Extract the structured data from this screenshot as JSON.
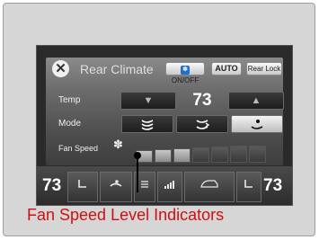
{
  "screen": {
    "title": "Rear Climate",
    "buttons": {
      "close_glyph": "✕",
      "onoff_icon": "fan-icon",
      "onoff_label": "ON/OFF",
      "auto_label": "AUTO",
      "rear_lock_label": "Rear Lock"
    },
    "rows": {
      "temp_label": "Temp",
      "mode_label": "Mode",
      "fan_label": "Fan Speed"
    },
    "temp": {
      "value": "73",
      "down_glyph": "▼",
      "up_glyph": "▲"
    },
    "modes": [
      {
        "icon": "face-vent-icon",
        "glyph": "⤳",
        "selected": false
      },
      {
        "icon": "face-floor-vent-icon",
        "glyph": "⤳",
        "selected": false
      },
      {
        "icon": "floor-vent-icon",
        "glyph": "⤳",
        "selected": true
      }
    ],
    "fan_speed": {
      "icon": "fan-icon",
      "glyph": "✽",
      "level": 3,
      "max_level": 7
    },
    "bottom_bar": {
      "left_temp": "73",
      "right_temp": "73",
      "icons": [
        "seat-heat-icon",
        "airflow-icon",
        "defrost-icon",
        "fan-level-icon",
        "recirculation-icon",
        "seat-heat-icon"
      ]
    }
  },
  "callout": {
    "caption": "Fan Speed Level Indicators",
    "color": "#d01010"
  }
}
